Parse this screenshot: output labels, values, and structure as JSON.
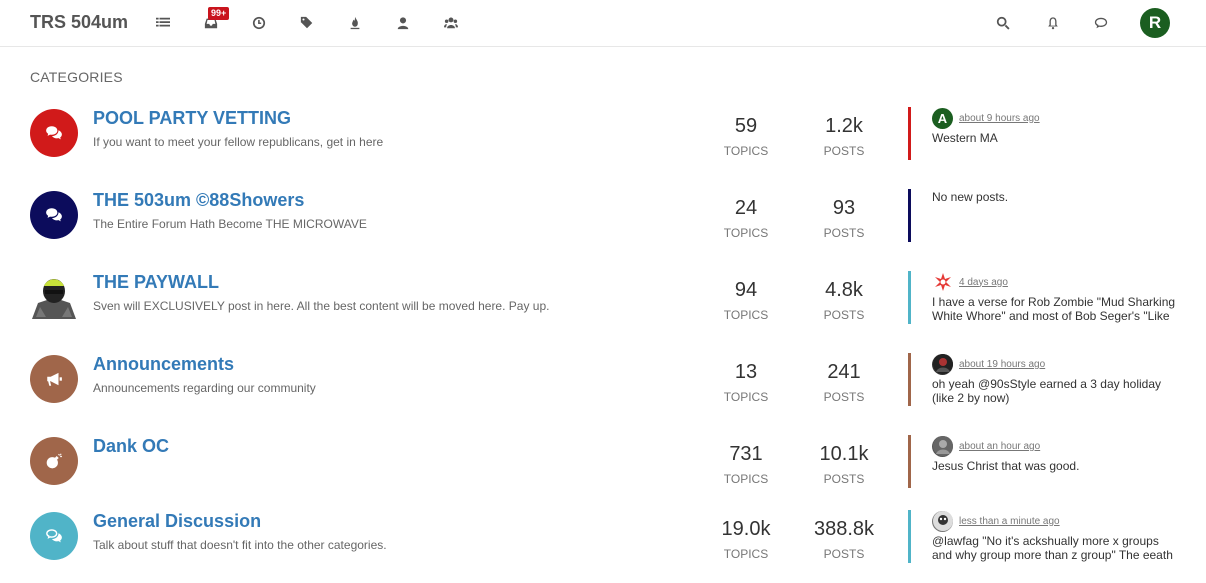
{
  "brand": "TRS 504um",
  "nav": {
    "items": [
      {
        "name": "categories-icon"
      },
      {
        "name": "unread-icon"
      },
      {
        "name": "recent-icon"
      },
      {
        "name": "tags-icon"
      },
      {
        "name": "popular-icon"
      },
      {
        "name": "users-icon"
      },
      {
        "name": "groups-icon"
      }
    ],
    "unread_badge": "99+",
    "user_initial": "R",
    "user_avatar_color": "#1b5e20"
  },
  "section_title": "CATEGORIES",
  "stats_labels": {
    "topics": "TOPICS",
    "posts": "POSTS"
  },
  "categories": [
    {
      "name": "POOL PARTY VETTING",
      "description": "If you want to meet your fellow republicans, get in here",
      "icon": "comments-icon",
      "color": "#d11a1a",
      "topics": "59",
      "posts": "1.2k",
      "teaser": {
        "avatar": "A",
        "avatar_color": "#1b5e20",
        "time": "about 9 hours ago",
        "content": "Western MA"
      }
    },
    {
      "name": "THE 503um ©88Showers",
      "description": "The Entire Forum Hath Become THE MICROWAVE",
      "icon": "comments-icon",
      "color": "#0c0c5c",
      "topics": "24",
      "posts": "93",
      "teaser": {
        "nonew": "No new posts."
      }
    },
    {
      "name": "THE PAYWALL",
      "description": "Sven will EXCLUSIVELY post in here. All the best content will be moved here. Pay up.",
      "icon": "image-avatar",
      "color": "#50b4c8",
      "topics": "94",
      "posts": "4.8k",
      "teaser": {
        "avatar": "",
        "avatar_color": "#e53935",
        "time": "4 days ago",
        "content": "I have a verse for Rob Zombie \"Mud Sharking White Whore\" and most of Bob Seger's \"Like"
      }
    },
    {
      "name": "Announcements",
      "description": "Announcements regarding our community",
      "icon": "bullhorn-icon",
      "color": "#a0664a",
      "topics": "13",
      "posts": "241",
      "teaser": {
        "avatar": "",
        "avatar_color": "#333333",
        "time": "about 19 hours ago",
        "content": "oh yeah @90sStyle earned a 3 day holiday (like 2 by now)"
      }
    },
    {
      "name": "Dank OC",
      "description": "",
      "icon": "bomb-icon",
      "color": "#a0664a",
      "topics": "731",
      "posts": "10.1k",
      "teaser": {
        "avatar": "",
        "avatar_color": "#555555",
        "time": "about an hour ago",
        "content": "Jesus Christ that was good."
      }
    },
    {
      "name": "General Discussion",
      "description": "Talk about stuff that doesn't fit into the other categories.",
      "icon": "comments-outline-icon",
      "color": "#50b4c8",
      "topics": "19.0k",
      "posts": "388.8k",
      "teaser": {
        "avatar": "",
        "avatar_color": "#777777",
        "time": "less than a minute ago",
        "content": "@lawfag \"No it's ackshually more x groups and why group more than z group\" The eeath"
      }
    }
  ]
}
